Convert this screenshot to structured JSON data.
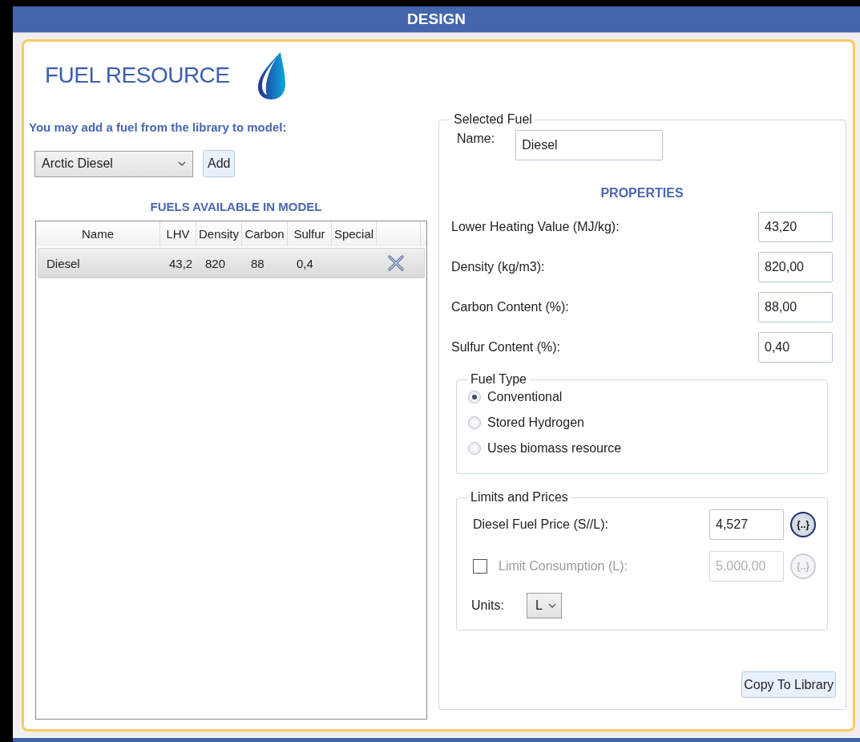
{
  "window": {
    "title": "DESIGN"
  },
  "header": {
    "title": "FUEL RESOURCE"
  },
  "library": {
    "prompt": "You may add a fuel from the library to model:",
    "selected_fuel": "Arctic Diesel",
    "add_button": "Add"
  },
  "fuels_table": {
    "title": "FUELS AVAILABLE IN MODEL",
    "columns": [
      "Name",
      "LHV",
      "Density",
      "Carbon",
      "Sulfur",
      "Special"
    ],
    "rows": [
      {
        "cells": [
          "Diesel",
          "43,2",
          "820",
          "88",
          "0,4"
        ],
        "selected": true
      }
    ]
  },
  "selected_fuel": {
    "legend": "Selected Fuel",
    "name_label": "Name:",
    "name_value": "Diesel",
    "properties_title": "PROPERTIES",
    "properties": [
      {
        "label": "Lower Heating Value (MJ/kg):",
        "value": "43,20"
      },
      {
        "label": "Density (kg/m3):",
        "value": "820,00"
      },
      {
        "label": "Carbon Content (%):",
        "value": "88,00"
      },
      {
        "label": "Sulfur Content (%):",
        "value": "0,40"
      }
    ]
  },
  "fuel_type": {
    "legend": "Fuel Type",
    "options": [
      {
        "label": "Conventional",
        "selected": true
      },
      {
        "label": "Stored Hydrogen",
        "selected": false
      },
      {
        "label": "Uses biomass resource",
        "selected": false
      }
    ]
  },
  "limits": {
    "legend": "Limits and Prices",
    "price": {
      "label": "Diesel Fuel Price (S//L):",
      "value": "4,527",
      "variable_button": "{..}",
      "disabled": false
    },
    "limit": {
      "label": "Limit Consumption (L):",
      "value": "5.000,00",
      "variable_button": "{..}",
      "checked": false,
      "disabled": true
    },
    "units": {
      "label": "Units:",
      "value": "L"
    }
  },
  "copy_button": "Copy To Library"
}
